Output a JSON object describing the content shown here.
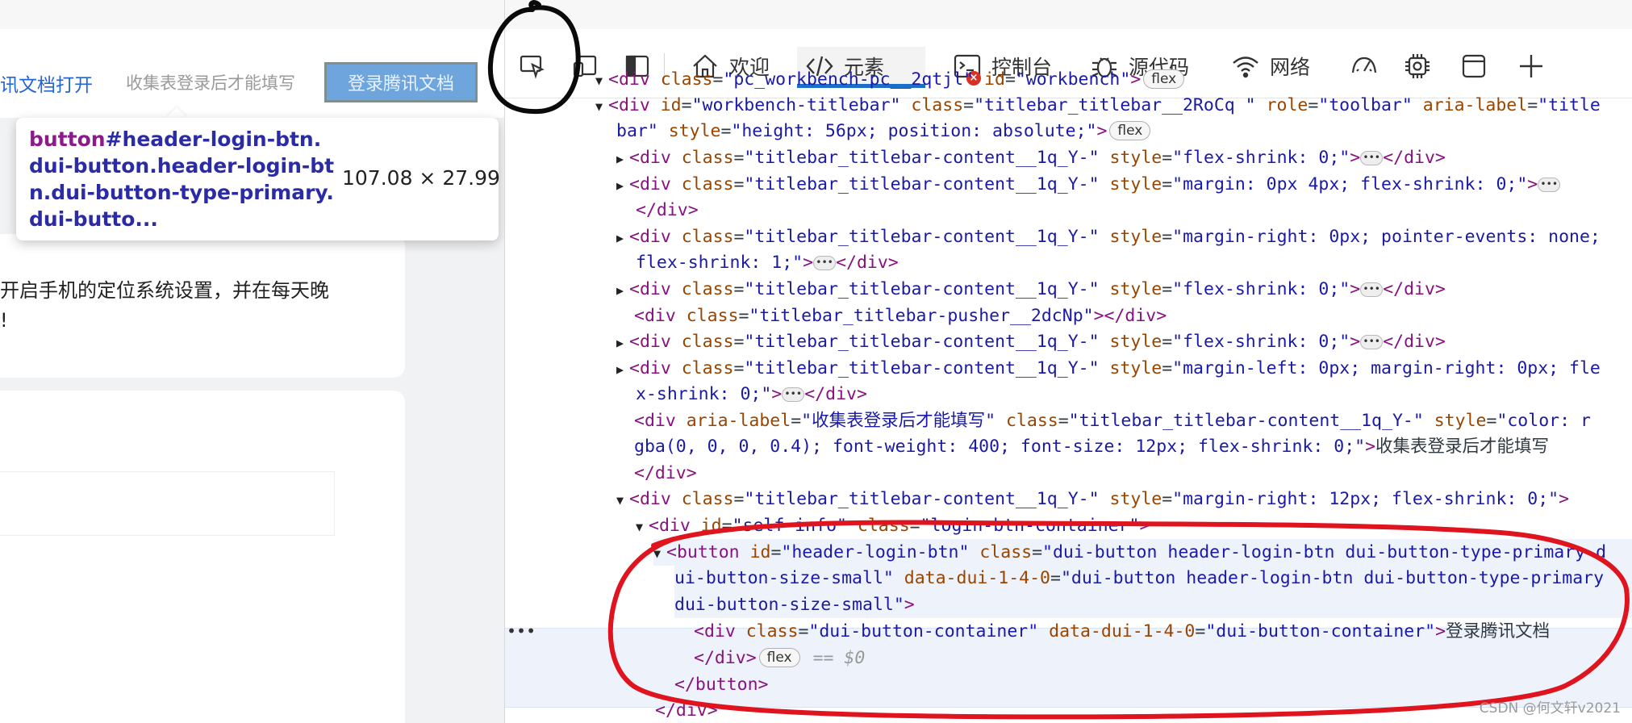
{
  "page": {
    "open_doc_link": "讯文档打开",
    "login_hint": "收集表登录后才能填写",
    "login_button": "登录腾讯文档",
    "card_text_1": "开启手机的定位系统设置，并在每天晚",
    "card_text_2": "!"
  },
  "tooltip": {
    "tag": "button",
    "selector": "#header-login-btn.dui-button.header-login-btn.dui-button-type-primary.dui-butto...",
    "dimensions": "107.08 × 27.99"
  },
  "devtools": {
    "tabs": [
      {
        "label": "欢迎",
        "icon": "home-icon"
      },
      {
        "label": "元素",
        "icon": "code-icon"
      },
      {
        "label": "控制台",
        "icon": "console-icon"
      },
      {
        "label": "源代码",
        "icon": "bug-icon"
      },
      {
        "label": "网络",
        "icon": "wifi-icon"
      }
    ],
    "error_count": "×",
    "tools": [
      "inspect-icon",
      "device-emulation-icon",
      "dock-side-icon",
      "performance-icon",
      "settings-gear-icon",
      "application-panel-icon",
      "add-tool-icon"
    ],
    "dom": {
      "l0": {
        "tag": "<div ",
        "attr1": "class",
        "val1": "\"pc_workbench-pc__2qtjl\"",
        "attr2": "id",
        "val2": "\"workbench\"",
        "badge": "flex"
      },
      "l1": {
        "open": "<div ",
        "a1": "id",
        "v1": "\"workbench-titlebar\"",
        "a2": "class",
        "v2": "\"titlebar_titlebar__2RoCq \"",
        "a3": "role",
        "v3": "\"toolbar\"",
        "a4": "aria-label",
        "v4a": "\"title"
      },
      "l2": {
        "v4b": "bar\"",
        "a5": "style",
        "v5": "\"height: 56px; position: absolute;\"",
        "close": ">",
        "badge": "flex"
      },
      "l3": {
        "open": "<div ",
        "a": "class",
        "v": "\"titlebar_titlebar-content__1q_Y-\"",
        "a2": "style",
        "v2": "\"flex-shrink: 0;\"",
        "mid": ">",
        "end": "</div>"
      },
      "l4": {
        "open": "<div ",
        "a": "class",
        "v": "\"titlebar_titlebar-content__1q_Y-\"",
        "a2": "style",
        "v2": "\"margin: 0px 4px; flex-shrink: 0;\"",
        "mid": ">"
      },
      "l5": {
        "end": "</div>"
      },
      "l6": {
        "open": "<div ",
        "a": "class",
        "v": "\"titlebar_titlebar-content__1q_Y-\"",
        "a2": "style",
        "v2": "\"margin-right: 0px; pointer-events: none;"
      },
      "l7": {
        "v2b": "flex-shrink: 1;\"",
        "mid": ">",
        "end": "</div>"
      },
      "l8": {
        "open": "<div ",
        "a": "class",
        "v": "\"titlebar_titlebar-content__1q_Y-\"",
        "a2": "style",
        "v2": "\"flex-shrink: 0;\"",
        "mid": ">",
        "end": "</div>"
      },
      "l9": {
        "open": "<div ",
        "a": "class",
        "v": "\"titlebar_titlebar-pusher__2dcNp\"",
        "end": "></div>"
      },
      "l10": {
        "open": "<div ",
        "a": "class",
        "v": "\"titlebar_titlebar-content__1q_Y-\"",
        "a2": "style",
        "v2": "\"flex-shrink: 0;\"",
        "mid": ">",
        "end": "</div>"
      },
      "l11": {
        "open": "<div ",
        "a": "class",
        "v": "\"titlebar_titlebar-content__1q_Y-\"",
        "a2": "style",
        "v2": "\"margin-left: 0px; margin-right: 0px; fle"
      },
      "l12": {
        "v2b": "x-shrink: 0;\"",
        "mid": ">",
        "end": "</div>"
      },
      "l13": {
        "open": "<div ",
        "a": "aria-label",
        "v": "\"收集表登录后才能填写\"",
        "a2": "class",
        "v2": "\"titlebar_titlebar-content__1q_Y-\"",
        "a3": "style",
        "v3": "\"color: r"
      },
      "l14": {
        "v3b": "gba(0, 0, 0, 0.4); font-weight: 400; font-size: 12px; flex-shrink: 0;\"",
        "mid": ">",
        "text": "收集表登录后才能填写"
      },
      "l15": {
        "end": "</div>"
      },
      "l16": {
        "open": "<div ",
        "a": "class",
        "v": "\"titlebar_titlebar-content__1q_Y-\"",
        "a2": "style",
        "v2": "\"margin-right: 12px; flex-shrink: 0;\"",
        "mid": ">"
      },
      "l17": {
        "open": "<div ",
        "a": "id",
        "v": "\"self-info\"",
        "a2": "class",
        "v2": "\"login-btn-container\"",
        "mid": ">"
      },
      "l18": {
        "open": "<button ",
        "a": "id",
        "v": "\"header-login-btn\"",
        "a2": "class",
        "v2": "\"dui-button header-login-btn dui-button-type-primary d"
      },
      "l19": {
        "v2b": "ui-button-size-small\"",
        "a3": "data-dui-1-4-0",
        "v3": "\"dui-button header-login-btn dui-button-type-primary"
      },
      "l20": {
        "v3b": "dui-button-size-small\"",
        "mid": ">"
      },
      "l21": {
        "open": "<div ",
        "a": "class",
        "v": "\"dui-button-container\"",
        "a2": "data-dui-1-4-0",
        "v2": "\"dui-button-container\"",
        "mid": ">",
        "text": "登录腾讯文档"
      },
      "l22": {
        "end": "</div>",
        "badge": "flex",
        "eq": "== $0"
      },
      "l23": {
        "end": "</button>"
      },
      "l24": {
        "end": "</div>"
      }
    },
    "gutter": "•••"
  },
  "watermark": "CSDN @何文轩v2021",
  "colors": {
    "accent": "#1a6fc8",
    "annotation": "#e0141e",
    "tag": "#881280",
    "attr_name": "#994500",
    "attr_value": "#1a1aa6"
  }
}
